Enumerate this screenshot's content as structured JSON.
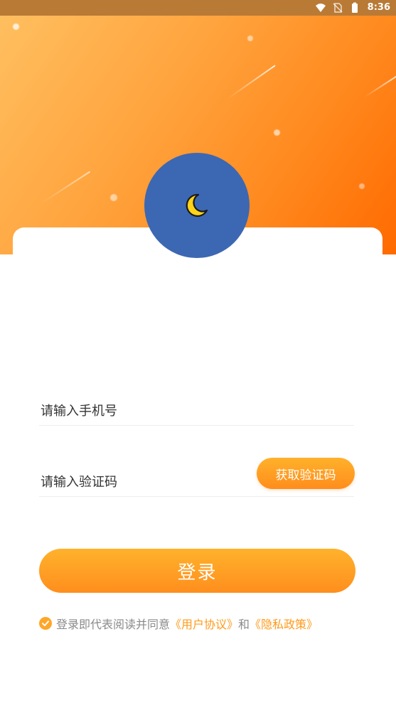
{
  "statusbar": {
    "time": "8:36",
    "icons": [
      "wifi-icon",
      "no-sim-icon",
      "battery-icon"
    ]
  },
  "avatar": {
    "icon": "moon-icon"
  },
  "form": {
    "phone_placeholder": "请输入手机号",
    "code_placeholder": "请输入验证码",
    "get_code_label": "获取验证码",
    "login_label": "登录"
  },
  "agreement": {
    "prefix": "登录即代表阅读并同意",
    "user_agreement": "《用户协议》",
    "conjunction": "和",
    "privacy_policy": "《隐私政策》"
  },
  "colors": {
    "accent": "#ff9a1a",
    "avatar_bg": "#3c67b3",
    "moon": "#ffd31a"
  }
}
